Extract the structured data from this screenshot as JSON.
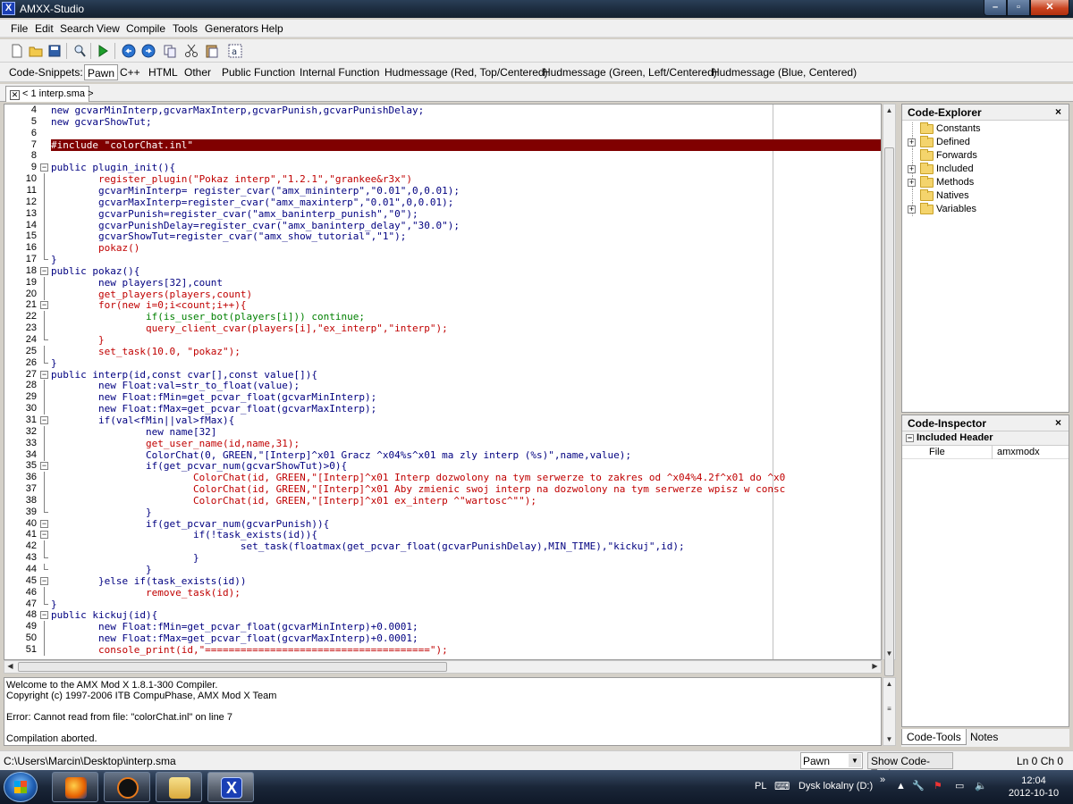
{
  "window": {
    "title": "AMXX-Studio"
  },
  "menu": [
    "File",
    "Edit",
    "Search",
    "View",
    "Compile",
    "Tools",
    "Generators",
    "Help"
  ],
  "snippets": {
    "label": "Code-Snippets:",
    "items": [
      "Pawn",
      "C++",
      "HTML",
      "Other",
      "Public Function",
      "Internal Function",
      "Hudmessage (Red, Top/Centered)",
      "Hudmessage (Green, Left/Centered)",
      "Hudmessage (Blue, Centered)"
    ]
  },
  "doc_tab": {
    "label": "< 1 interp.sma >"
  },
  "code_lines": [
    {
      "n": "4",
      "t": "new gcvarMinInterp,gcvarMaxInterp,gcvarPunish,gcvarPunishDelay;",
      "c": "#000080",
      "f": ""
    },
    {
      "n": "5",
      "t": "new gcvarShowTut;",
      "c": "#000080",
      "f": ""
    },
    {
      "n": "6",
      "t": "",
      "c": "#000080",
      "f": ""
    },
    {
      "n": "7",
      "t": "#include \"colorChat.inl\"",
      "c": "#ffffff",
      "f": "",
      "err": true
    },
    {
      "n": "8",
      "t": "",
      "c": "#000080",
      "f": ""
    },
    {
      "n": "9",
      "t": "public plugin_init(){",
      "c": "#000080",
      "f": "open"
    },
    {
      "n": "10",
      "t": "        register_plugin(\"Pokaz interp\",\"1.2.1\",\"grankee&r3x\")",
      "c": "#c00000",
      "f": "line"
    },
    {
      "n": "11",
      "t": "        gcvarMinInterp= register_cvar(\"amx_mininterp\",\"0.01\",0,0.01);",
      "c": "#000080",
      "f": "line"
    },
    {
      "n": "12",
      "t": "        gcvarMaxInterp=register_cvar(\"amx_maxinterp\",\"0.01\",0,0.01);",
      "c": "#000080",
      "f": "line"
    },
    {
      "n": "13",
      "t": "        gcvarPunish=register_cvar(\"amx_baninterp_punish\",\"0\");",
      "c": "#000080",
      "f": "line"
    },
    {
      "n": "14",
      "t": "        gcvarPunishDelay=register_cvar(\"amx_baninterp_delay\",\"30.0\");",
      "c": "#000080",
      "f": "line"
    },
    {
      "n": "15",
      "t": "        gcvarShowTut=register_cvar(\"amx_show_tutorial\",\"1\");",
      "c": "#000080",
      "f": "line"
    },
    {
      "n": "16",
      "t": "        pokaz()",
      "c": "#c00000",
      "f": "line"
    },
    {
      "n": "17",
      "t": "}",
      "c": "#000080",
      "f": "end"
    },
    {
      "n": "18",
      "t": "public pokaz(){",
      "c": "#000080",
      "f": "open"
    },
    {
      "n": "19",
      "t": "        new players[32],count",
      "c": "#000080",
      "f": "line"
    },
    {
      "n": "20",
      "t": "        get_players(players,count)",
      "c": "#c00000",
      "f": "line"
    },
    {
      "n": "21",
      "t": "        for(new i=0;i<count;i++){",
      "c": "#c00000",
      "f": "open"
    },
    {
      "n": "22",
      "t": "                if(is_user_bot(players[i])) continue;",
      "c": "#008000",
      "f": "line"
    },
    {
      "n": "23",
      "t": "                query_client_cvar(players[i],\"ex_interp\",\"interp\");",
      "c": "#c00000",
      "f": "line"
    },
    {
      "n": "24",
      "t": "        }",
      "c": "#c00000",
      "f": "end"
    },
    {
      "n": "25",
      "t": "        set_task(10.0, \"pokaz\");",
      "c": "#c00000",
      "f": "line"
    },
    {
      "n": "26",
      "t": "}",
      "c": "#000080",
      "f": "end"
    },
    {
      "n": "27",
      "t": "public interp(id,const cvar[],const value[]){",
      "c": "#000080",
      "f": "open"
    },
    {
      "n": "28",
      "t": "        new Float:val=str_to_float(value);",
      "c": "#000080",
      "f": "line"
    },
    {
      "n": "29",
      "t": "        new Float:fMin=get_pcvar_float(gcvarMinInterp);",
      "c": "#000080",
      "f": "line"
    },
    {
      "n": "30",
      "t": "        new Float:fMax=get_pcvar_float(gcvarMaxInterp);",
      "c": "#000080",
      "f": "line"
    },
    {
      "n": "31",
      "t": "        if(val<fMin||val>fMax){",
      "c": "#000080",
      "f": "open"
    },
    {
      "n": "32",
      "t": "                new name[32]",
      "c": "#000080",
      "f": "line"
    },
    {
      "n": "33",
      "t": "                get_user_name(id,name,31);",
      "c": "#c00000",
      "f": "line"
    },
    {
      "n": "34",
      "t": "                ColorChat(0, GREEN,\"[Interp]^x01 Gracz ^x04%s^x01 ma zly interp (%s)\",name,value);",
      "c": "#000080",
      "f": "line"
    },
    {
      "n": "35",
      "t": "                if(get_pcvar_num(gcvarShowTut)>0){",
      "c": "#000080",
      "f": "open"
    },
    {
      "n": "36",
      "t": "                        ColorChat(id, GREEN,\"[Interp]^x01 Interp dozwolony na tym serwerze to zakres od ^x04%4.2f^x01 do ^x0",
      "c": "#c00000",
      "f": "line"
    },
    {
      "n": "37",
      "t": "                        ColorChat(id, GREEN,\"[Interp]^x01 Aby zmienic swoj interp na dozwolony na tym serwerze wpisz w consc",
      "c": "#c00000",
      "f": "line"
    },
    {
      "n": "38",
      "t": "                        ColorChat(id, GREEN,\"[Interp]^x01 ex_interp ^\"wartosc^\"\");",
      "c": "#c00000",
      "f": "line"
    },
    {
      "n": "39",
      "t": "                }",
      "c": "#000080",
      "f": "end"
    },
    {
      "n": "40",
      "t": "                if(get_pcvar_num(gcvarPunish)){",
      "c": "#000080",
      "f": "open"
    },
    {
      "n": "41",
      "t": "                        if(!task_exists(id)){",
      "c": "#000080",
      "f": "open"
    },
    {
      "n": "42",
      "t": "                                set_task(floatmax(get_pcvar_float(gcvarPunishDelay),MIN_TIME),\"kickuj\",id);",
      "c": "#000080",
      "f": "line"
    },
    {
      "n": "43",
      "t": "                        }",
      "c": "#000080",
      "f": "end"
    },
    {
      "n": "44",
      "t": "                }",
      "c": "#000080",
      "f": "end"
    },
    {
      "n": "45",
      "t": "        }else if(task_exists(id))",
      "c": "#000080",
      "f": "open"
    },
    {
      "n": "46",
      "t": "                remove_task(id);",
      "c": "#c00000",
      "f": "line"
    },
    {
      "n": "47",
      "t": "}",
      "c": "#000080",
      "f": "end"
    },
    {
      "n": "48",
      "t": "public kickuj(id){",
      "c": "#000080",
      "f": "open"
    },
    {
      "n": "49",
      "t": "        new Float:fMin=get_pcvar_float(gcvarMinInterp)+0.0001;",
      "c": "#000080",
      "f": "line"
    },
    {
      "n": "50",
      "t": "        new Float:fMax=get_pcvar_float(gcvarMaxInterp)+0.0001;",
      "c": "#000080",
      "f": "line"
    },
    {
      "n": "51",
      "t": "        console_print(id,\"======================================\");",
      "c": "#c00000",
      "f": "line"
    }
  ],
  "output": [
    "Welcome to the AMX Mod X 1.8.1-300 Compiler.",
    "Copyright (c) 1997-2006 ITB CompuPhase, AMX Mod X Team",
    "",
    "Error: Cannot read from file: \"colorChat.inl\" on line 7",
    "",
    "Compilation aborted."
  ],
  "code_explorer": {
    "title": "Code-Explorer",
    "close": "×",
    "items": [
      {
        "label": "Constants",
        "expand": ""
      },
      {
        "label": "Defined",
        "expand": "+"
      },
      {
        "label": "Forwards",
        "expand": ""
      },
      {
        "label": "Included",
        "expand": "+"
      },
      {
        "label": "Methods",
        "expand": "+"
      },
      {
        "label": "Natives",
        "expand": ""
      },
      {
        "label": "Variables",
        "expand": "+"
      }
    ]
  },
  "code_inspector": {
    "title": "Code-Inspector",
    "close": "×",
    "section": "Included Header",
    "expand": "−",
    "row": {
      "key": "File",
      "value": "amxmodx"
    }
  },
  "panel_tabs": [
    "Code-Tools",
    "Notes"
  ],
  "status": {
    "path": "C:\\Users\\Marcin\\Desktop\\interp.sma",
    "language": "Pawn",
    "show_code_tools": "Show Code-Tools",
    "position": "Ln 0 Ch 0"
  },
  "taskbar": {
    "lang": "PL",
    "disk": "Dysk lokalny (D:)",
    "chevron": "»",
    "time": "12:04",
    "date": "2012-10-10"
  }
}
